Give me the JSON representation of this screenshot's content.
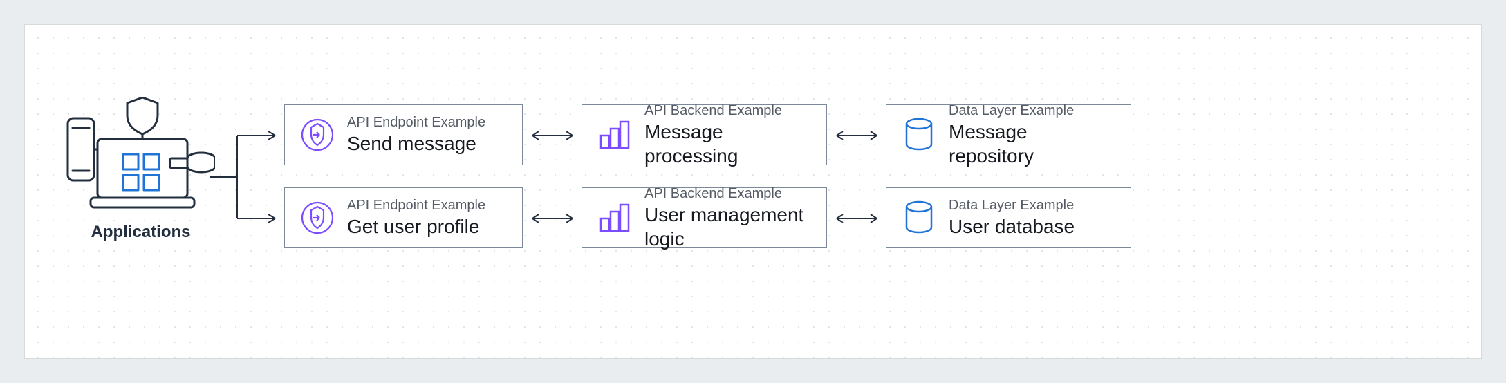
{
  "applications_label": "Applications",
  "rows": [
    {
      "endpoint": {
        "subtitle": "API Endpoint Example",
        "title": "Send message"
      },
      "backend": {
        "subtitle": "API Backend Example",
        "title": "Message processing"
      },
      "data": {
        "subtitle": "Data Layer Example",
        "title": "Message repository"
      }
    },
    {
      "endpoint": {
        "subtitle": "API Endpoint Example",
        "title": "Get user profile"
      },
      "backend": {
        "subtitle": "API Backend Example",
        "title": "User management logic"
      },
      "data": {
        "subtitle": "Data Layer Example",
        "title": "User database"
      }
    }
  ],
  "colors": {
    "endpoint_icon": "#7c4dff",
    "backend_icon": "#7c4dff",
    "data_icon": "#2074d5"
  }
}
